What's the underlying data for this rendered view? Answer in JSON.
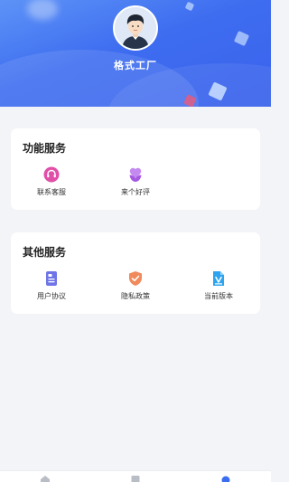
{
  "profile": {
    "name": "格式工厂",
    "avatar_icon": "user-avatar"
  },
  "sections": {
    "function": {
      "title": "功能服务",
      "items": [
        {
          "label": "联系客服",
          "icon": "customer-service-icon",
          "color": "#e04fa8"
        },
        {
          "label": "来个好评",
          "icon": "thumbs-up-icon",
          "color": "#b36be8"
        }
      ]
    },
    "other": {
      "title": "其他服务",
      "items": [
        {
          "label": "用户协议",
          "icon": "document-icon",
          "color": "#6f74e6"
        },
        {
          "label": "隐私政策",
          "icon": "shield-check-icon",
          "color": "#f08a5b"
        },
        {
          "label": "当前版本",
          "icon": "version-file-icon",
          "color": "#2ea4ee"
        }
      ]
    }
  },
  "tabbar": {
    "tabs": [
      {
        "icon": "home-icon",
        "color": "#b9bdc6"
      },
      {
        "icon": "tools-icon",
        "color": "#b9bdc6"
      },
      {
        "icon": "profile-icon",
        "color": "#3b6df0"
      }
    ]
  },
  "colors": {
    "header_start": "#5d93f7",
    "header_end": "#3a62ec",
    "page_background": "#f2f4f7",
    "active_tab": "#3b6df0"
  }
}
